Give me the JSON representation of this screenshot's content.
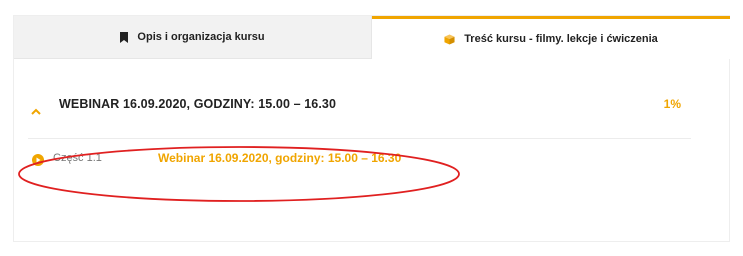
{
  "tabs": [
    {
      "label": "Opis i organizacja kursu",
      "icon": "bookmark-icon",
      "active": false
    },
    {
      "label": "Treść kursu - filmy. lekcje i ćwiczenia",
      "icon": "box-icon",
      "active": true
    }
  ],
  "section": {
    "title": "WEBINAR 16.09.2020, GODZINY: 15.00 – 16.30",
    "progress": "1%",
    "expanded": true
  },
  "lessons": [
    {
      "part": "Część 1.1",
      "title": "Webinar 16.09.2020, godziny: 15.00 – 16.30"
    }
  ],
  "colors": {
    "accent": "#f0a500",
    "annotation": "#e02020",
    "text": "#222222",
    "muted": "#777777"
  }
}
